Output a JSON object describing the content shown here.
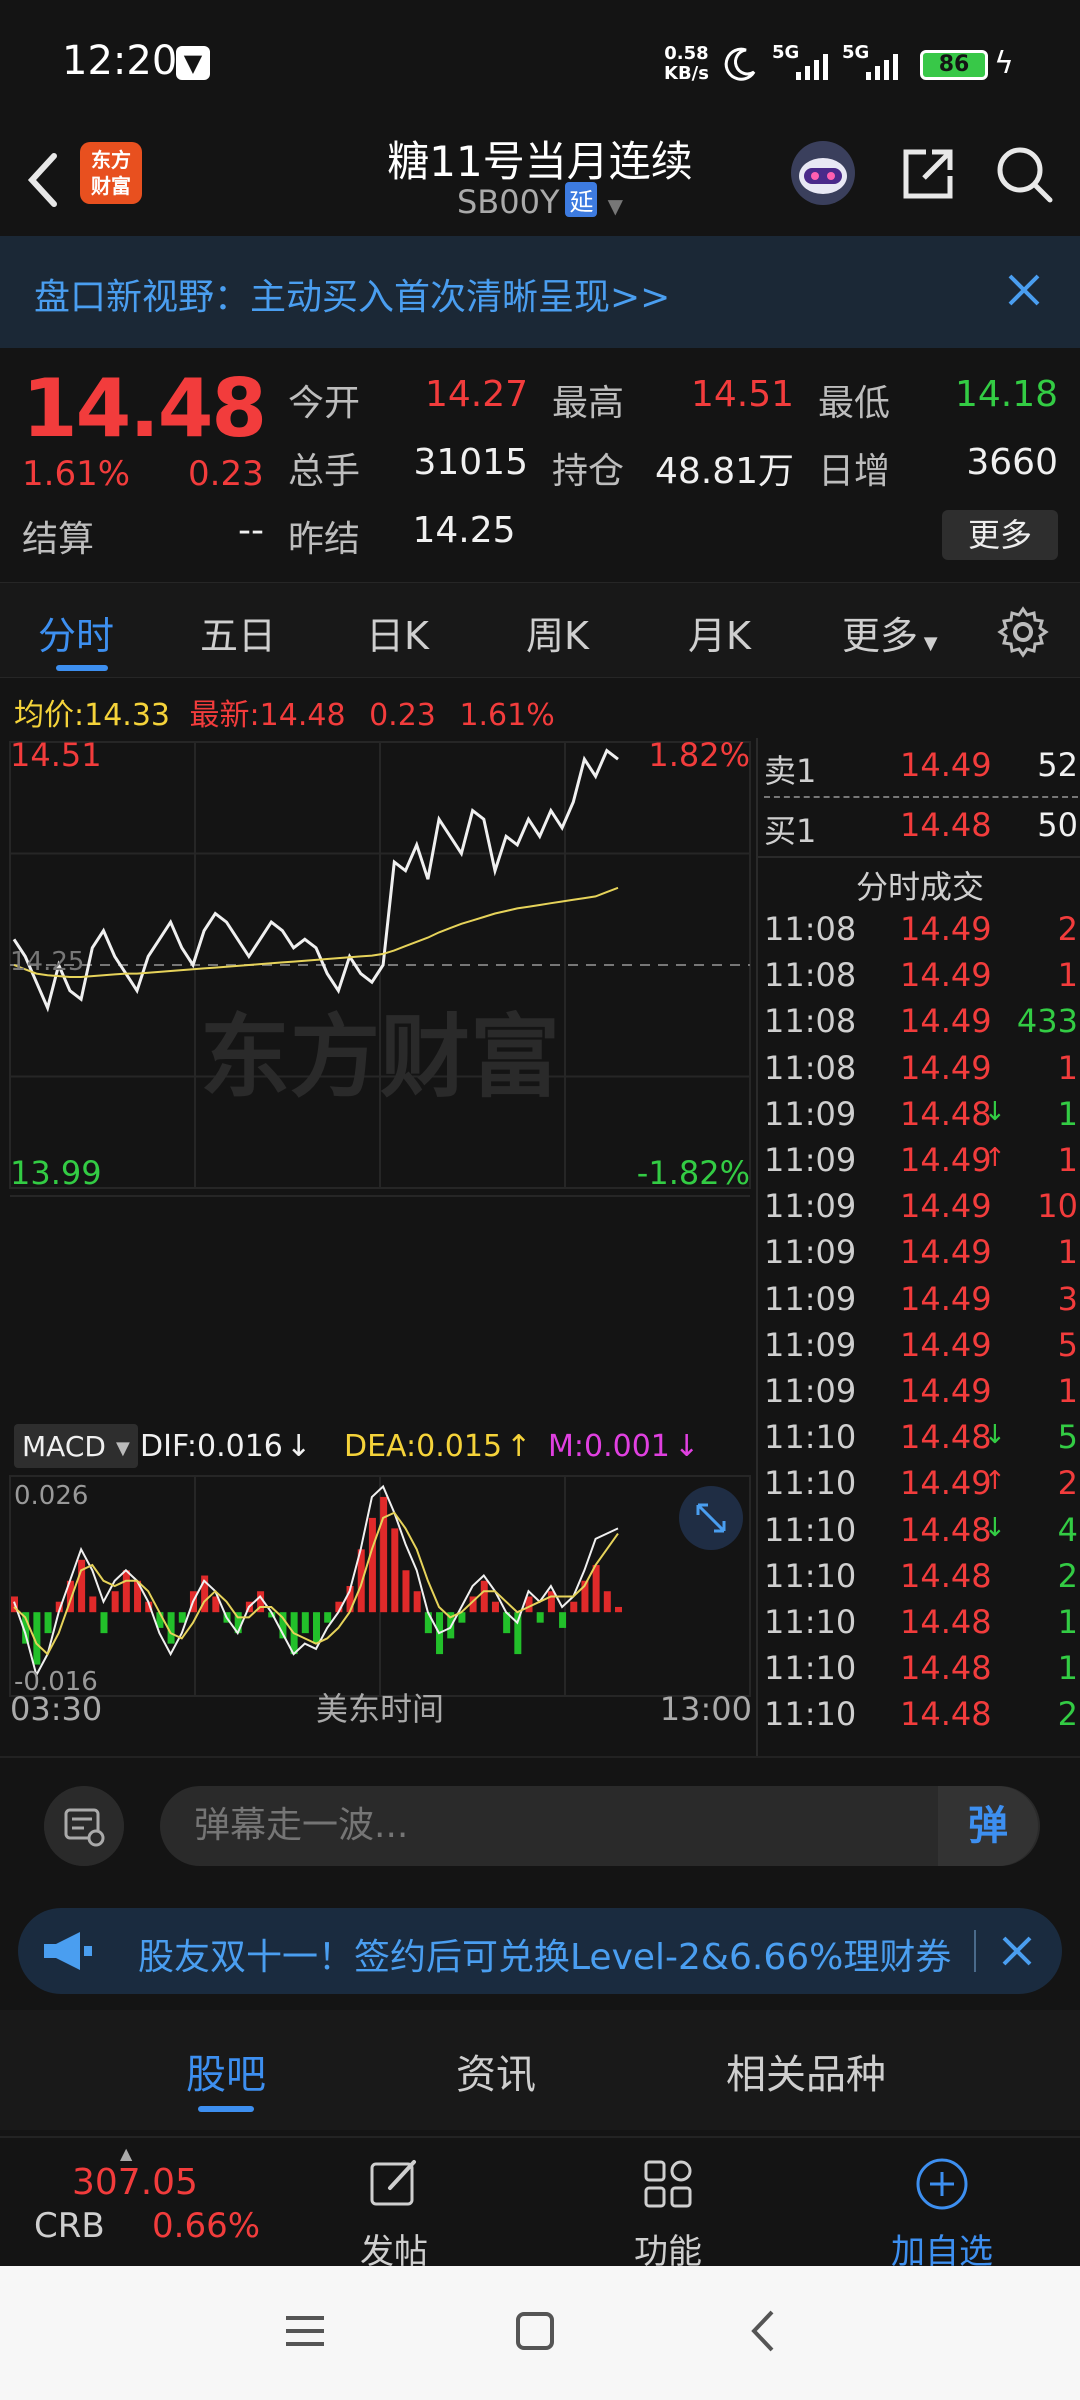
{
  "status_bar": {
    "time": "12:20",
    "net_speed_value": "0.58",
    "net_speed_unit": "KB/s",
    "network_1": "5G",
    "network_2": "5G",
    "battery": "86"
  },
  "header": {
    "logo_line1": "东方",
    "logo_line2": "财富",
    "title": "糖11号当月连续",
    "code": "SB00Y",
    "delay_badge": "延"
  },
  "banner": {
    "text": "盘口新视野：主动买入首次清晰呈现>>"
  },
  "quote": {
    "price": "14.48",
    "change_pct": "1.61%",
    "change": "0.23",
    "rows": [
      [
        {
          "label": "今开",
          "value": "14.27",
          "color": "#f23c3c"
        },
        {
          "label": "最高",
          "value": "14.51",
          "color": "#f23c3c"
        },
        {
          "label": "最低",
          "value": "14.18",
          "color": "#33cc44"
        }
      ],
      [
        {
          "label": "总手",
          "value": "31015",
          "color": "#f0f0f0"
        },
        {
          "label": "持仓",
          "value": "48.81万",
          "color": "#f0f0f0"
        },
        {
          "label": "日增",
          "value": "3660",
          "color": "#f0f0f0"
        }
      ]
    ],
    "settle_label": "结算",
    "settle_value": "--",
    "prev_close_label": "昨结",
    "prev_close_value": "14.25",
    "more_label": "更多"
  },
  "tabs": {
    "items": [
      "分时",
      "五日",
      "日K",
      "周K",
      "月K",
      "更多"
    ],
    "active": "分时"
  },
  "avg_line": {
    "avg_label": "均价:",
    "avg_value": "14.33",
    "latest_label": "最新:",
    "latest_value": "14.48",
    "change": "0.23",
    "pct": "1.61%"
  },
  "chart_data": [
    {
      "type": "line",
      "title": "",
      "y_top_label": "14.51",
      "y_bottom_label": "13.99",
      "pct_top_label": "1.82%",
      "pct_bottom_label": "-1.82%",
      "mid_label": "14.25",
      "ylim": [
        13.99,
        14.51
      ],
      "watermark": "东方财富",
      "x_start_label": "03:30",
      "x_mid_label": "美东时间",
      "x_end_label": "13:00",
      "series": [
        {
          "name": "",
          "color": "#f0f0f0",
          "values": [
            14.28,
            14.26,
            14.23,
            14.2,
            14.25,
            14.22,
            14.21,
            14.27,
            14.29,
            14.26,
            14.24,
            14.22,
            14.26,
            14.28,
            14.3,
            14.27,
            14.25,
            14.29,
            14.31,
            14.3,
            14.28,
            14.26,
            14.28,
            14.3,
            14.29,
            14.27,
            14.28,
            14.27,
            14.24,
            14.22,
            14.26,
            14.24,
            14.23,
            14.25,
            14.37,
            14.36,
            14.39,
            14.35,
            14.42,
            14.4,
            14.38,
            14.43,
            14.42,
            14.36,
            14.4,
            14.39,
            14.42,
            14.4,
            14.43,
            14.41,
            14.44,
            14.49,
            14.47,
            14.5,
            14.49
          ]
        },
        {
          "name": "",
          "color": "#e6d35a",
          "values": [
            14.25,
            14.245,
            14.24,
            14.238,
            14.237,
            14.236,
            14.236,
            14.237,
            14.238,
            14.239,
            14.24,
            14.24,
            14.241,
            14.242,
            14.243,
            14.244,
            14.245,
            14.246,
            14.247,
            14.248,
            14.249,
            14.25,
            14.251,
            14.252,
            14.253,
            14.254,
            14.255,
            14.256,
            14.257,
            14.258,
            14.259,
            14.26,
            14.261,
            14.263,
            14.267,
            14.272,
            14.277,
            14.282,
            14.288,
            14.293,
            14.298,
            14.302,
            14.306,
            14.31,
            14.313,
            14.316,
            14.318,
            14.32,
            14.322,
            14.324,
            14.326,
            14.328,
            14.33,
            14.335,
            14.34
          ]
        }
      ]
    },
    {
      "type": "bar",
      "title": "MACD",
      "legend": {
        "macd_label": "MACD",
        "dif": "DIF:0.016",
        "dea": "DEA:0.015",
        "m": "M:0.001"
      },
      "y_top_label": "0.026",
      "y_bottom_label": "-0.016",
      "ylim": [
        -0.016,
        0.026
      ],
      "series": [
        {
          "name": "M",
          "values": [
            0.003,
            -0.006,
            -0.01,
            -0.004,
            0.002,
            0.006,
            0.01,
            0.003,
            -0.004,
            0.004,
            0.008,
            0.006,
            0.002,
            -0.003,
            -0.006,
            -0.002,
            0.004,
            0.007,
            0.003,
            -0.002,
            -0.004,
            0.002,
            0.004,
            -0.001,
            -0.005,
            -0.008,
            -0.004,
            -0.006,
            -0.002,
            0.002,
            0.005,
            0.012,
            0.018,
            0.022,
            0.016,
            0.008,
            0.004,
            -0.004,
            -0.008,
            -0.005,
            -0.002,
            0.003,
            0.006,
            0.002,
            -0.004,
            -0.008,
            0.003,
            -0.002,
            0.004,
            -0.003,
            0.002,
            0.006,
            0.009,
            0.004,
            0.001
          ]
        },
        {
          "name": "DIF",
          "color": "#f0f0f0",
          "values": [
            0.002,
            -0.004,
            -0.012,
            -0.008,
            0.0,
            0.006,
            0.012,
            0.008,
            0.002,
            0.006,
            0.008,
            0.006,
            0.002,
            -0.004,
            -0.008,
            -0.004,
            0.002,
            0.006,
            0.004,
            -0.001,
            -0.004,
            0.001,
            0.003,
            0.0,
            -0.004,
            -0.008,
            -0.006,
            -0.007,
            -0.003,
            0.0,
            0.004,
            0.012,
            0.022,
            0.024,
            0.019,
            0.013,
            0.008,
            0.0,
            -0.004,
            -0.003,
            0.001,
            0.005,
            0.007,
            0.004,
            0.0,
            -0.002,
            0.004,
            0.002,
            0.005,
            0.001,
            0.003,
            0.008,
            0.014,
            0.015,
            0.016
          ]
        },
        {
          "name": "DEA",
          "color": "#e6d35a",
          "values": [
            0.001,
            -0.001,
            -0.006,
            -0.008,
            -0.004,
            0.002,
            0.008,
            0.009,
            0.006,
            0.005,
            0.006,
            0.006,
            0.004,
            0.0,
            -0.004,
            -0.005,
            -0.002,
            0.002,
            0.004,
            0.002,
            -0.001,
            -0.001,
            0.001,
            0.001,
            -0.001,
            -0.004,
            -0.005,
            -0.006,
            -0.005,
            -0.003,
            0.0,
            0.005,
            0.012,
            0.018,
            0.019,
            0.016,
            0.012,
            0.006,
            0.001,
            -0.001,
            0.0,
            0.002,
            0.004,
            0.004,
            0.002,
            0.0,
            0.001,
            0.002,
            0.003,
            0.003,
            0.003,
            0.005,
            0.009,
            0.012,
            0.015
          ]
        }
      ]
    }
  ],
  "order_book": {
    "ask_label": "卖1",
    "ask_price": "14.49",
    "ask_vol": "52",
    "bid_label": "买1",
    "bid_price": "14.48",
    "bid_vol": "50",
    "ticks_title": "分时成交",
    "ticks": [
      {
        "time": "11:08",
        "price": "14.49",
        "arrow": "",
        "vol": "2",
        "vol_color": "#f23c3c"
      },
      {
        "time": "11:08",
        "price": "14.49",
        "arrow": "",
        "vol": "1",
        "vol_color": "#f23c3c"
      },
      {
        "time": "11:08",
        "price": "14.49",
        "arrow": "",
        "vol": "433",
        "vol_color": "#33cc44"
      },
      {
        "time": "11:08",
        "price": "14.49",
        "arrow": "",
        "vol": "1",
        "vol_color": "#f23c3c"
      },
      {
        "time": "11:09",
        "price": "14.48",
        "arrow": "↓",
        "vol": "1",
        "vol_color": "#33cc44"
      },
      {
        "time": "11:09",
        "price": "14.49",
        "arrow": "↑",
        "vol": "1",
        "vol_color": "#f23c3c"
      },
      {
        "time": "11:09",
        "price": "14.49",
        "arrow": "",
        "vol": "10",
        "vol_color": "#f23c3c"
      },
      {
        "time": "11:09",
        "price": "14.49",
        "arrow": "",
        "vol": "1",
        "vol_color": "#f23c3c"
      },
      {
        "time": "11:09",
        "price": "14.49",
        "arrow": "",
        "vol": "3",
        "vol_color": "#f23c3c"
      },
      {
        "time": "11:09",
        "price": "14.49",
        "arrow": "",
        "vol": "5",
        "vol_color": "#f23c3c"
      },
      {
        "time": "11:09",
        "price": "14.49",
        "arrow": "",
        "vol": "1",
        "vol_color": "#f23c3c"
      },
      {
        "time": "11:10",
        "price": "14.48",
        "arrow": "↓",
        "vol": "5",
        "vol_color": "#33cc44"
      },
      {
        "time": "11:10",
        "price": "14.49",
        "arrow": "↑",
        "vol": "2",
        "vol_color": "#f23c3c"
      },
      {
        "time": "11:10",
        "price": "14.48",
        "arrow": "↓",
        "vol": "4",
        "vol_color": "#33cc44"
      },
      {
        "time": "11:10",
        "price": "14.48",
        "arrow": "",
        "vol": "2",
        "vol_color": "#33cc44"
      },
      {
        "time": "11:10",
        "price": "14.48",
        "arrow": "",
        "vol": "1",
        "vol_color": "#33cc44"
      },
      {
        "time": "11:10",
        "price": "14.48",
        "arrow": "",
        "vol": "1",
        "vol_color": "#33cc44"
      },
      {
        "time": "11:10",
        "price": "14.48",
        "arrow": "",
        "vol": "2",
        "vol_color": "#33cc44"
      }
    ]
  },
  "danmu": {
    "placeholder": "弹幕走一波...",
    "send_label": "弹"
  },
  "promo": {
    "text": "股友双十一！签约后可兑换Level-2&6.66%理财券"
  },
  "bottom_tabs": {
    "items": [
      "股吧",
      "资讯",
      "相关品种"
    ],
    "active": "股吧"
  },
  "action_bar": {
    "index_value": "307.05",
    "index_name": "CRB",
    "index_pct": "0.66%",
    "post_label": "发帖",
    "function_label": "功能",
    "watchlist_label": "加自选"
  },
  "colors": {
    "up": "#f23c3c",
    "down": "#33cc44",
    "accent": "#3d8ff0",
    "avg": "#e6d35a"
  }
}
